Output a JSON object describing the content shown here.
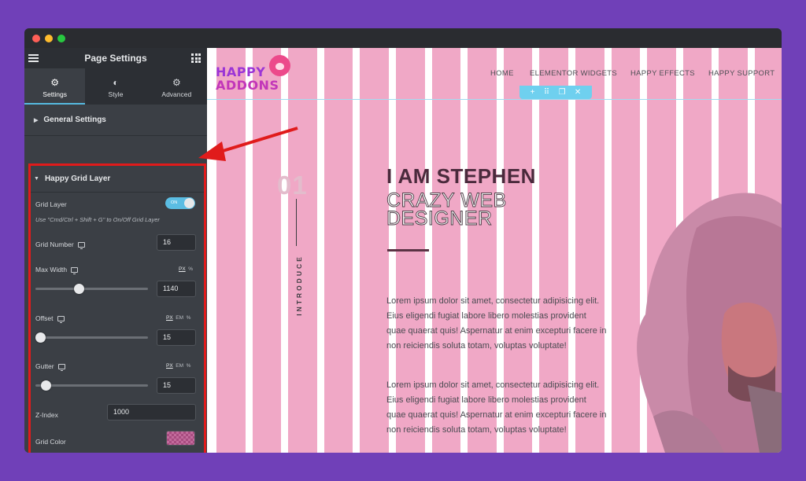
{
  "sidebar": {
    "title": "Page Settings",
    "tabs": [
      {
        "label": "Settings",
        "icon": "gear-icon"
      },
      {
        "label": "Style",
        "icon": "half-circle-icon"
      },
      {
        "label": "Advanced",
        "icon": "gear-icon"
      }
    ],
    "general_section": "General Settings",
    "grid_section": {
      "title": "Happy Grid Layer",
      "grid_layer_label": "Grid Layer",
      "toggle_text": "ON",
      "hint": "Use \"Cmd/Ctrl + Shift + G\" to On/Off Grid Layer",
      "grid_number_label": "Grid Number",
      "grid_number_value": "16",
      "max_width_label": "Max Width",
      "max_width_units": [
        "PX",
        "%"
      ],
      "max_width_value": "1140",
      "max_width_slider": 0.38,
      "offset_label": "Offset",
      "offset_units": [
        "PX",
        "EM",
        "%"
      ],
      "offset_value": "15",
      "offset_slider": 0.0,
      "gutter_label": "Gutter",
      "gutter_units": [
        "PX",
        "EM",
        "%"
      ],
      "gutter_value": "15",
      "gutter_slider": 0.05,
      "zindex_label": "Z-Index",
      "zindex_value": "1000",
      "grid_color_label": "Grid Color",
      "grid_color": "#c26b9c"
    }
  },
  "preview": {
    "logo_line1": "HAPPY",
    "logo_line2": "ADDONS",
    "nav": [
      "HOME",
      "ELEMENTOR WIDGETS",
      "HAPPY EFFECTS",
      "HAPPY SUPPORT"
    ],
    "number": "01",
    "vertical_label": "INTRODUCE",
    "heading": "I AM STEPHEN",
    "subheading": "CRAZY WEB DESIGNER",
    "paragraphs": [
      "Lorem ipsum dolor sit amet, consectetur adipisicing elit. Eius eligendi fugiat labore libero molestias provident quae quaerat quis! Aspernatur at enim excepturi facere in non reiciendis soluta totam, voluptas voluptate!",
      "Lorem ipsum dolor sit amet, consectetur adipisicing elit. Eius eligendi fugiat labore libero molestias provident quae quaerat quis! Aspernatur at enim excepturi facere in non reiciendis soluta totam, voluptas voluptate!"
    ],
    "grid_column_color": "#f0a8c6",
    "grid_columns": 16
  }
}
